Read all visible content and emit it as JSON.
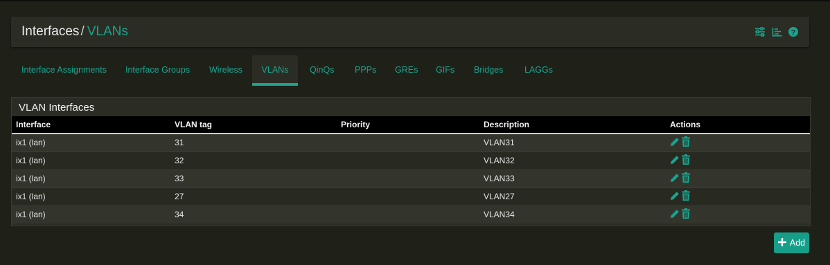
{
  "breadcrumb": {
    "parent": "Interfaces",
    "separator": "/",
    "current": "VLANs"
  },
  "header_icons": [
    "sliders-icon",
    "list-chart-icon",
    "help-icon"
  ],
  "tabs": [
    {
      "label": "Interface Assignments",
      "active": false
    },
    {
      "label": "Interface Groups",
      "active": false
    },
    {
      "label": "Wireless",
      "active": false
    },
    {
      "label": "VLANs",
      "active": true
    },
    {
      "label": "QinQs",
      "active": false
    },
    {
      "label": "PPPs",
      "active": false
    },
    {
      "label": "GREs",
      "active": false
    },
    {
      "label": "GIFs",
      "active": false
    },
    {
      "label": "Bridges",
      "active": false
    },
    {
      "label": "LAGGs",
      "active": false
    }
  ],
  "panel": {
    "title": "VLAN Interfaces",
    "columns": [
      "Interface",
      "VLAN tag",
      "Priority",
      "Description",
      "Actions"
    ],
    "rows": [
      {
        "interface": "ix1 (lan)",
        "tag": "31",
        "priority": "",
        "description": "VLAN31"
      },
      {
        "interface": "ix1 (lan)",
        "tag": "32",
        "priority": "",
        "description": "VLAN32"
      },
      {
        "interface": "ix1 (lan)",
        "tag": "33",
        "priority": "",
        "description": "VLAN33"
      },
      {
        "interface": "ix1 (lan)",
        "tag": "27",
        "priority": "",
        "description": "VLAN27"
      },
      {
        "interface": "ix1 (lan)",
        "tag": "34",
        "priority": "",
        "description": "VLAN34"
      }
    ]
  },
  "add_button": {
    "label": "Add"
  },
  "colors": {
    "accent": "#1aa38e",
    "background": "#1f2119",
    "panel": "#2b2d24"
  }
}
